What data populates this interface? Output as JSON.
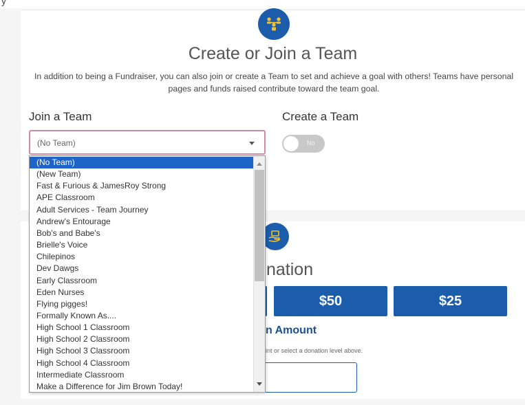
{
  "page": {
    "top_fragment": "y"
  },
  "team_section": {
    "heading": "Create or Join a Team",
    "description": "In addition to being a Fundraiser, you can also join or create a Team to set and achieve a goal with others! Teams have personal pages and funds raised contribute toward the team goal.",
    "icon": "team-people-icon",
    "join_label": "Join a Team",
    "create_label": "Create a Team",
    "select_value": "(No Team)",
    "toggle_text": "No",
    "toggle_on": false
  },
  "team_options": [
    "(No Team)",
    "(New Team)",
    "Fast & Furious & JamesRoy Strong",
    "APE Classroom",
    "Adult Services - Team Journey",
    "Andrew's Entourage",
    "Bob's and Babe's",
    "Brielle's Voice",
    "Chilepinos",
    "Dev Dawgs",
    "Early Classroom",
    "Eden Nurses",
    "Flying pigges!",
    "Formally Known As....",
    "High School 1 Classroom",
    "High School 2 Classroom",
    "High School 3 Classroom",
    "High School 4 Classroom",
    "Intermediate Classroom",
    "Make a Difference for Jim Brown Today!"
  ],
  "donation_section": {
    "icon": "donation-hand-icon",
    "heading_partial": "nation",
    "amounts": [
      "$50",
      "$25"
    ],
    "other_label_partial": "n Amount",
    "other_hint_partial": "int or select a donation level above.",
    "other_input_value": ""
  },
  "colors": {
    "brand_blue": "#1b5dab",
    "selected_option": "#1e64c8",
    "select_border": "#d58aa3",
    "toggle_off": "#c8c8c8"
  }
}
